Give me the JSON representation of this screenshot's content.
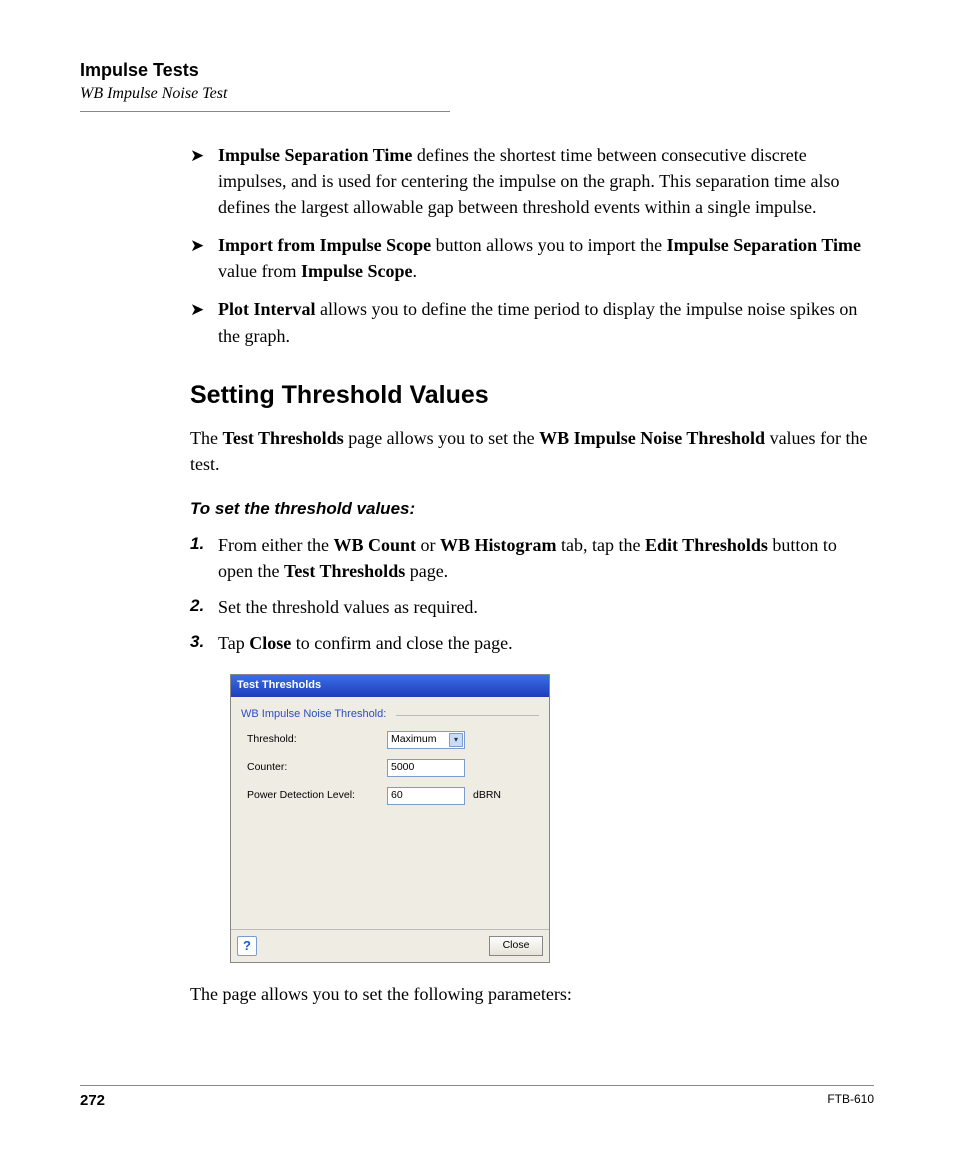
{
  "header": {
    "title": "Impulse Tests",
    "subtitle": "WB Impulse Noise Test"
  },
  "bullets": [
    {
      "lead": "Impulse Separation Time",
      "rest": " defines the shortest time between consecutive discrete impulses, and is used for centering the impulse on the graph. This separation time also defines the largest allowable gap between threshold events within a single impulse."
    },
    {
      "html": "<b>Import from Impulse Scope</b> button allows you to import the <b>Impulse Separation Time</b> value from <b>Impulse Scope</b>."
    },
    {
      "lead": "Plot Interval",
      "rest": " allows you to define the time period to display the impulse noise spikes on the graph."
    }
  ],
  "section_heading": "Setting Threshold Values",
  "intro_html": "The <b>Test Thresholds</b> page allows you to set the <b>WB Impulse Noise Threshold</b> values for the test.",
  "instruction_heading": "To set the threshold values:",
  "steps": [
    {
      "n": "1.",
      "html": "From either the <b>WB Count</b> or <b>WB Histogram</b> tab, tap the <b>Edit Thresholds</b> button to open the <b>Test Thresholds</b> page."
    },
    {
      "n": "2.",
      "html": "Set the threshold values as required."
    },
    {
      "n": "3.",
      "html": "Tap <b>Close</b> to confirm and close the page."
    }
  ],
  "dialog": {
    "title": "Test Thresholds",
    "group": "WB Impulse Noise Threshold:",
    "rows": {
      "threshold": {
        "label": "Threshold:",
        "value": "Maximum",
        "type": "dropdown"
      },
      "counter": {
        "label": "Counter:",
        "value": "5000",
        "type": "text"
      },
      "pdl": {
        "label": "Power Detection Level:",
        "value": "60",
        "unit": "dBRN",
        "type": "text"
      }
    },
    "help": "?",
    "close": "Close"
  },
  "closing": "The page allows you to set the following parameters:",
  "footer": {
    "page": "272",
    "docid": "FTB-610"
  }
}
